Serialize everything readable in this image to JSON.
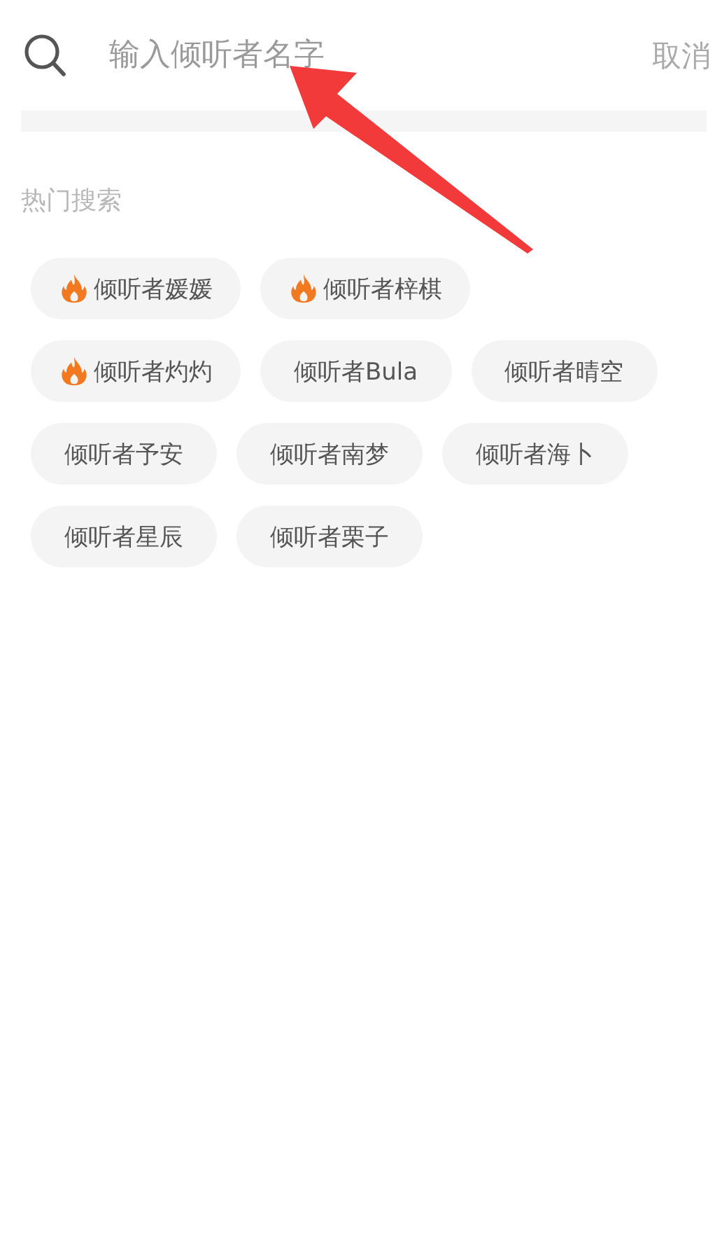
{
  "search": {
    "placeholder": "输入倾听者名字",
    "cancel": "取消"
  },
  "hot_searches": {
    "title": "热门搜索",
    "tags": [
      {
        "label": "倾听者媛媛",
        "hot": true
      },
      {
        "label": "倾听者梓棋",
        "hot": true
      },
      {
        "label": "倾听者灼灼",
        "hot": true
      },
      {
        "label": "倾听者Bula",
        "hot": false
      },
      {
        "label": "倾听者晴空",
        "hot": false
      },
      {
        "label": "倾听者予安",
        "hot": false
      },
      {
        "label": "倾听者南梦",
        "hot": false
      },
      {
        "label": "倾听者海卜",
        "hot": false
      },
      {
        "label": "倾听者星辰",
        "hot": false
      },
      {
        "label": "倾听者栗子",
        "hot": false
      }
    ]
  }
}
